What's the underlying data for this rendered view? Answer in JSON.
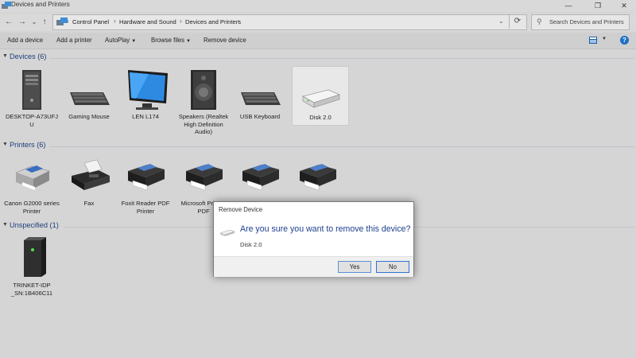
{
  "window": {
    "title": "Devices and Printers",
    "icons": {
      "app": "devices-printers-icon",
      "minimize": "minimize-icon",
      "maximize": "maximize-icon",
      "close": "close-icon"
    }
  },
  "nav": {
    "back": "←",
    "forward": "→",
    "dropdown": "⌄",
    "up": "↑"
  },
  "address": {
    "icon": "devices-printers-icon",
    "crumbs": [
      "Control Panel",
      "Hardware and Sound",
      "Devices and Printers"
    ],
    "separator": "›",
    "refresh_icon": "refresh-icon"
  },
  "search": {
    "placeholder": "Search Devices and Printers",
    "icon": "search-icon"
  },
  "toolbar": {
    "add_device": "Add a device",
    "add_printer": "Add a printer",
    "autoplay": "AutoPlay",
    "browse_files": "Browse files",
    "remove_device": "Remove device",
    "view_icon": "view-options-icon",
    "help_icon": "help-icon",
    "help_glyph": "?"
  },
  "sections": {
    "devices": {
      "label": "Devices (6)",
      "items": [
        {
          "label": "DESKTOP-A73UFJ U",
          "icon": "computer-tower-icon"
        },
        {
          "label": "Gaming Mouse",
          "icon": "keyboard-icon"
        },
        {
          "label": "LEN L174",
          "icon": "monitor-icon"
        },
        {
          "label": "Speakers (Realtek High Definition Audio)",
          "icon": "speaker-icon"
        },
        {
          "label": "USB Keyboard",
          "icon": "keyboard-icon"
        },
        {
          "label": "Disk 2.0",
          "icon": "usb-drive-icon"
        }
      ]
    },
    "printers": {
      "label": "Printers (6)",
      "items": [
        {
          "label": "Canon G2000 series Printer",
          "icon": "printer-icon"
        },
        {
          "label": "Fax",
          "icon": "fax-icon"
        },
        {
          "label": "Foxit Reader PDF Printer",
          "icon": "printer-icon"
        },
        {
          "label": "Microsoft Print to PDF",
          "icon": "printer-icon"
        },
        {
          "label": "",
          "icon": "printer-icon"
        },
        {
          "label": "",
          "icon": "printer-icon"
        }
      ]
    },
    "unspecified": {
      "label": "Unspecified (1)",
      "items": [
        {
          "label": "TRINKET-IDP _SN:1B406C11",
          "icon": "device-box-icon"
        }
      ]
    }
  },
  "dialog": {
    "title": "Remove Device",
    "question": "Are you sure you want to remove this device?",
    "device": "Disk 2.0",
    "yes": "Yes",
    "no": "No"
  },
  "colors": {
    "section_heading": "#1e3d7a",
    "dialog_question": "#1d3f8f",
    "accent": "#1f6fc5"
  }
}
